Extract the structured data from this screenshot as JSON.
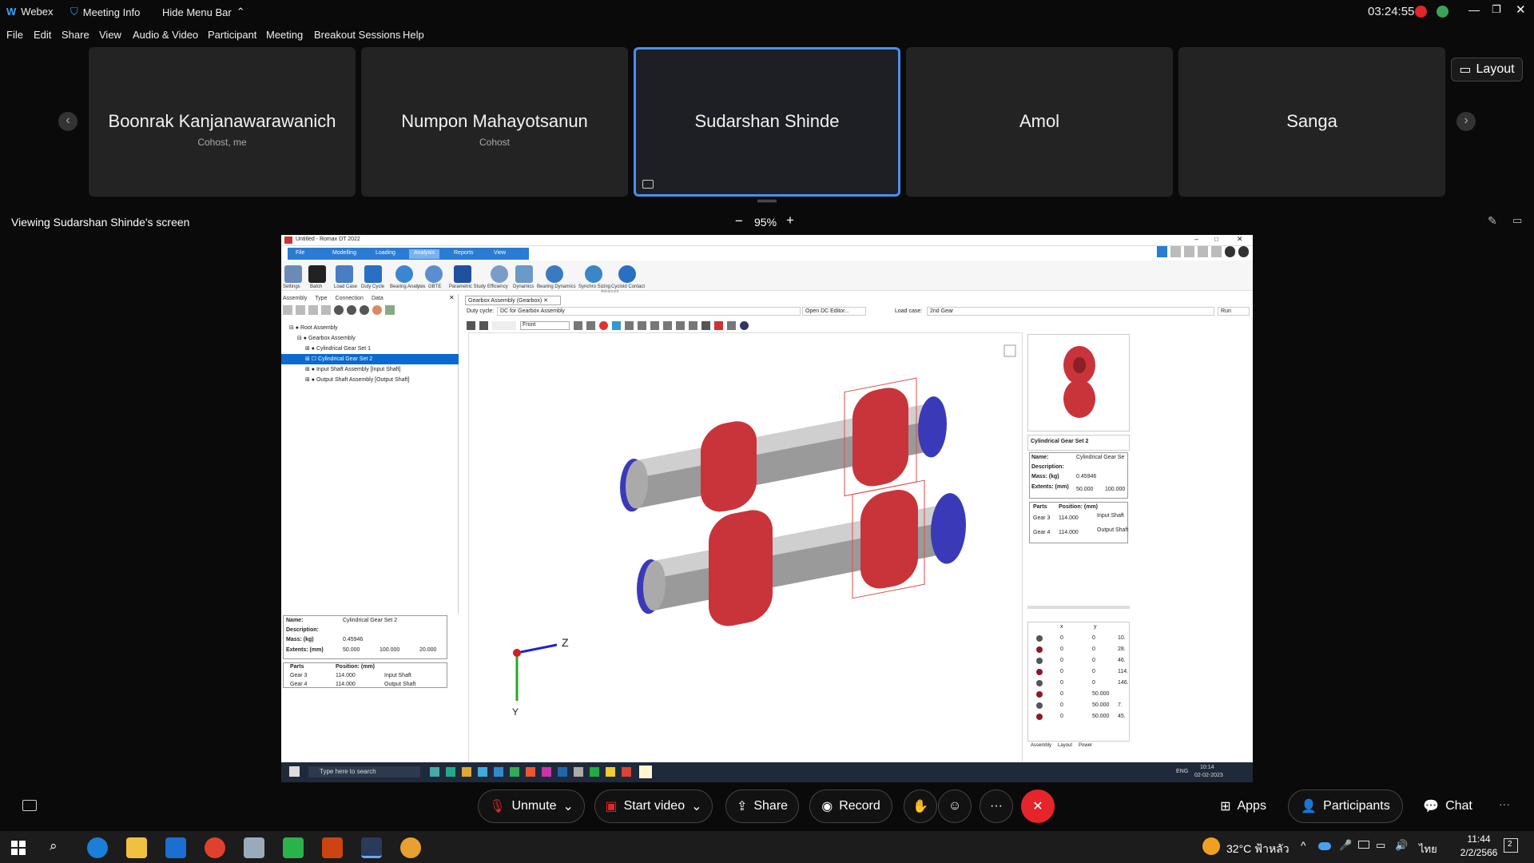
{
  "titlebar": {
    "app": "Webex",
    "meeting_info": "Meeting Info",
    "hide_menu": "Hide Menu Bar",
    "clock": "03:24:55"
  },
  "menu": [
    "File",
    "Edit",
    "Share",
    "View",
    "Audio & Video",
    "Participant",
    "Meeting",
    "Breakout Sessions",
    "Help"
  ],
  "participants": [
    {
      "name": "Boonrak Kanjanawarawanich",
      "role": "Cohost, me"
    },
    {
      "name": "Numpon Mahayotsanun",
      "role": "Cohost"
    },
    {
      "name": "Sudarshan Shinde",
      "role": ""
    },
    {
      "name": "Amol",
      "role": ""
    },
    {
      "name": "Sanga",
      "role": ""
    }
  ],
  "layout_label": "Layout",
  "viewing": "Viewing Sudarshan Shinde's screen",
  "zoom": "95%",
  "shared_app": {
    "title": "Untitled - Romax DT 2022",
    "ribbon_tabs": [
      "File",
      "Modelling",
      "Loading",
      "Analysis",
      "Reports",
      "View"
    ],
    "tools": [
      "Settings",
      "Batch",
      "Load Case",
      "Duty Cycle",
      "Bearing Analysis",
      "GBTE",
      "Parametric Study",
      "Efficiency",
      "Dynamics",
      "Bearing Dynamics",
      "Synchro Sizing",
      "Cycloid Contact"
    ],
    "group_run": "Run",
    "group_advanced": "Advanced",
    "panel_tabs": [
      "Assembly",
      "Type",
      "Connection",
      "Data"
    ],
    "tree": [
      "Root Assembly",
      "Gearbox Assembly",
      "Cylindrical Gear Set 1",
      "Cylindrical Gear Set 2",
      "Input Shaft Assembly [Input Shaft]",
      "Output Shaft Assembly [Output Shaft]"
    ],
    "doc_tab": "Gearbox Assembly (Gearbox)",
    "duty_cycle_label": "Duty cycle:",
    "duty_cycle_value": "DC for Gearbox Assembly",
    "open_dc": "Open DC Editor...",
    "load_case_label": "Load case:",
    "load_case_value": "2nd Gear",
    "run": "Run",
    "view_value": "Front",
    "props": {
      "name_label": "Name:",
      "name": "Cylindrical Gear Set 2",
      "desc_label": "Description:",
      "mass_label": "Mass: (kg)",
      "mass": "0.45946",
      "extents_label": "Extents: (mm)",
      "ext1": "50.000",
      "ext2": "100.000",
      "ext3": "20.000"
    },
    "parts_header": [
      "Parts",
      "Position: (mm)"
    ],
    "parts": [
      {
        "p": "Gear 3",
        "pos": "114.000",
        "s": "Input Shaft"
      },
      {
        "p": "Gear 4",
        "pos": "114.000",
        "s": "Output Shaft"
      }
    ],
    "right_title": "Cylindrical Gear Set 2",
    "right_props": {
      "name": "Cylindrical Gear Se",
      "mass": "0.45946",
      "ext1": "50.000",
      "ext2": "100.000"
    },
    "right_parts": [
      {
        "p": "Gear 3",
        "pos": "114.000",
        "s": "Input Shaft"
      },
      {
        "p": "Gear 4",
        "pos": "114.000",
        "s": "Output Shaft"
      }
    ],
    "grid_cols": [
      "x",
      "y"
    ],
    "grid_rows": [
      [
        "0",
        "0",
        "10."
      ],
      [
        "0",
        "0",
        "28."
      ],
      [
        "0",
        "0",
        "46."
      ],
      [
        "0",
        "0",
        "114."
      ],
      [
        "0",
        "0",
        "146."
      ],
      [
        "0",
        "50.000",
        ""
      ],
      [
        "0",
        "50.000",
        "7."
      ],
      [
        "0",
        "50.000",
        "45."
      ]
    ],
    "bottom_tabs": [
      "Assembly",
      "Layout",
      "Power"
    ],
    "axis_z": "Z",
    "axis_y": "Y",
    "inner_search": "Type here to search",
    "inner_lang": "ENG",
    "inner_time": "10:14",
    "inner_date": "02-02-2023"
  },
  "controls": {
    "unmute": "Unmute",
    "start_video": "Start video",
    "share": "Share",
    "record": "Record",
    "apps": "Apps",
    "participants": "Participants",
    "chat": "Chat"
  },
  "taskbar": {
    "weather": "32°C ฟ้าหลัว",
    "lang": "ไทย",
    "time": "11:44",
    "date": "2/2/2566",
    "notif": "2"
  },
  "colors": {
    "accent": "#4a8ff0",
    "leave": "#e5242b",
    "gear": "#c8343a",
    "shaft": "#9a9a9a",
    "bearing": "#3a3ab8"
  }
}
